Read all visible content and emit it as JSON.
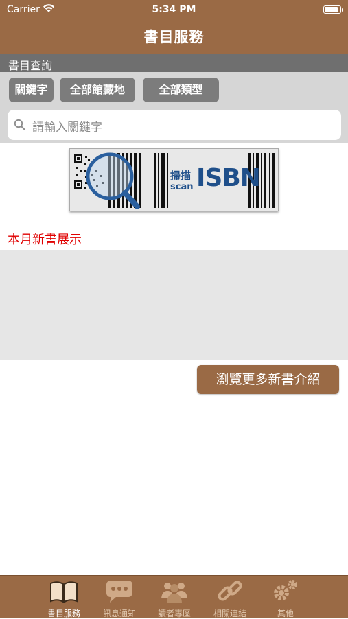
{
  "status_bar": {
    "carrier": "Carrier",
    "time": "5:34 PM"
  },
  "nav": {
    "title": "書目服務"
  },
  "search_section": {
    "header": "書目查詢",
    "filters": [
      "關鍵字",
      "全部館藏地",
      "全部類型"
    ],
    "search_placeholder": "請輸入關鍵字"
  },
  "scan_banner": {
    "label_zh": "掃描",
    "label_en": "scan",
    "label_isbn": "ISBN"
  },
  "new_books": {
    "title": "本月新書展示",
    "more_button": "瀏覽更多新書介紹"
  },
  "tab_bar": {
    "items": [
      {
        "label": "書目服務",
        "icon": "book-icon",
        "active": true
      },
      {
        "label": "訊息通知",
        "icon": "message-icon",
        "active": false
      },
      {
        "label": "讀者專區",
        "icon": "users-icon",
        "active": false
      },
      {
        "label": "相關連結",
        "icon": "link-icon",
        "active": false
      },
      {
        "label": "其他",
        "icon": "gear-icon",
        "active": false
      }
    ]
  },
  "colors": {
    "brand": "#9a6a45",
    "filter_button": "#7c7c7c",
    "accent_red": "#e00000"
  }
}
